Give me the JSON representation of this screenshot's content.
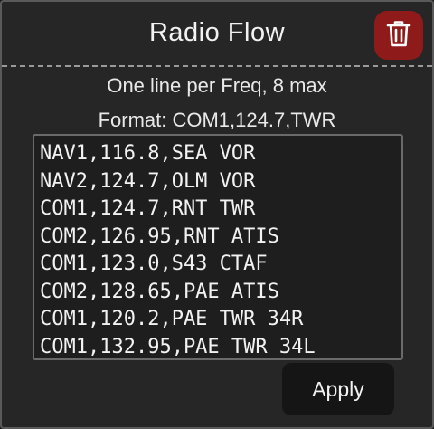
{
  "panel": {
    "title": "Radio Flow",
    "delete_icon": "trash-icon"
  },
  "instructions": {
    "line1": "One line per Freq, 8 max",
    "line2": "Format: COM1,124.7,TWR"
  },
  "frequencies": {
    "lines": [
      "NAV1,116.8,SEA VOR",
      "NAV2,124.7,OLM VOR",
      "COM1,124.7,RNT TWR",
      "COM2,126.95,RNT ATIS",
      "COM1,123.0,S43 CTAF",
      "COM2,128.65,PAE ATIS",
      "COM1,120.2,PAE TWR 34R",
      "COM1,132.95,PAE TWR 34L"
    ]
  },
  "actions": {
    "apply_label": "Apply"
  },
  "colors": {
    "delete_button": "#8e1a1a",
    "panel_background": "#262626",
    "text": "#f2f2f2"
  }
}
